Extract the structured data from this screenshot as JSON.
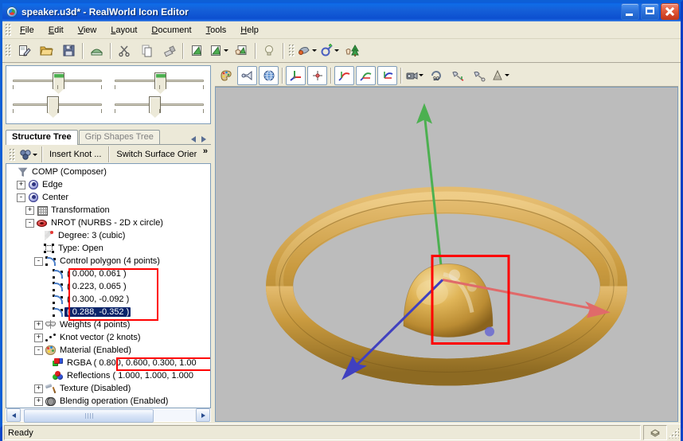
{
  "window": {
    "title": "speaker.u3d* - RealWorld Icon Editor",
    "app_icon": "realworld-logo-icon",
    "minimize_label": "Minimize",
    "maximize_label": "Maximize",
    "close_label": "Close"
  },
  "menu": {
    "items": [
      {
        "label": "File",
        "mnemonic": "F"
      },
      {
        "label": "Edit",
        "mnemonic": "E"
      },
      {
        "label": "View",
        "mnemonic": "V"
      },
      {
        "label": "Layout",
        "mnemonic": "L"
      },
      {
        "label": "Document",
        "mnemonic": "D"
      },
      {
        "label": "Tools",
        "mnemonic": "T"
      },
      {
        "label": "Help",
        "mnemonic": "H"
      }
    ]
  },
  "toolbar": {
    "buttons": [
      {
        "name": "new-icon",
        "tip": "New"
      },
      {
        "name": "open-folder-icon",
        "tip": "Open"
      },
      {
        "name": "save-floppy-icon",
        "tip": "Save"
      },
      {
        "name": "print-icon",
        "tip": "Print"
      },
      {
        "name": "cut-scissors-icon",
        "tip": "Cut"
      },
      {
        "name": "copy-icon",
        "tip": "Copy"
      },
      {
        "name": "paste-brush-icon",
        "tip": "Paste"
      },
      {
        "name": "undo-icon",
        "tip": "Undo"
      },
      {
        "name": "redo-icon",
        "tip": "Redo"
      },
      {
        "name": "apply-hand-icon",
        "tip": "Apply"
      },
      {
        "name": "light-bulb-icon",
        "tip": "Hints"
      },
      {
        "name": "color-dropper-icon",
        "tip": "Color"
      },
      {
        "name": "add-object-icon",
        "tip": "Add object"
      },
      {
        "name": "tree-object-icon",
        "tip": "Object library"
      }
    ]
  },
  "sliders": {
    "rows": [
      {
        "name": "slider-top-left",
        "value_pct": 50,
        "accent": "#4caf50"
      },
      {
        "name": "slider-bottom-left",
        "value_pct": 44,
        "accent": ""
      },
      {
        "name": "slider-top-right",
        "value_pct": 50,
        "accent": "#4caf50"
      },
      {
        "name": "slider-bottom-right",
        "value_pct": 44,
        "accent": ""
      }
    ]
  },
  "tabs": {
    "items": [
      {
        "label": "Structure Tree",
        "active": true
      },
      {
        "label": "Grip Shapes Tree",
        "active": false
      }
    ],
    "nav_prev": "scroll-tabs-left",
    "nav_next": "scroll-tabs-right"
  },
  "tree_toolbar": {
    "dropdown_icon": "object-menu-icon",
    "buttons": [
      {
        "label": "Insert Knot ..."
      },
      {
        "label": "Switch Surface Orier"
      }
    ],
    "overflow_label": "»"
  },
  "tree": {
    "nodes": [
      {
        "label": "COMP (Composer)",
        "depth": 0,
        "expander": "",
        "icon": "comp-funnel-icon"
      },
      {
        "label": "Edge",
        "depth": 1,
        "expander": "+",
        "icon": "edge-node-icon"
      },
      {
        "label": "Center",
        "depth": 1,
        "expander": "-",
        "icon": "center-node-icon"
      },
      {
        "label": "Transformation",
        "depth": 2,
        "expander": "+",
        "icon": "transformation-grid-icon"
      },
      {
        "label": "NROT (NURBS - 2D x circle)",
        "depth": 2,
        "expander": "-",
        "icon": "nrot-torus-icon"
      },
      {
        "label": "Degree: 3 (cubic)",
        "depth": 3,
        "expander": "",
        "icon": "degree-thermometer-icon"
      },
      {
        "label": "Type: Open",
        "depth": 3,
        "expander": "",
        "icon": "type-polygon-icon"
      },
      {
        "label": "Control polygon (4 points)",
        "depth": 3,
        "expander": "-",
        "icon": "control-polygon-icon"
      },
      {
        "label": "( 0.000, 0.061 )",
        "depth": 4,
        "expander": "",
        "icon": "control-point-icon"
      },
      {
        "label": "( 0.223, 0.065 )",
        "depth": 4,
        "expander": "",
        "icon": "control-point-icon"
      },
      {
        "label": "( 0.300, -0.092 )",
        "depth": 4,
        "expander": "",
        "icon": "control-point-icon"
      },
      {
        "label": "( 0.288, -0.352 )",
        "depth": 4,
        "expander": "",
        "icon": "control-point-icon",
        "selected": true
      },
      {
        "label": "Weights (4 points)",
        "depth": 3,
        "expander": "+",
        "icon": "weights-scale-icon"
      },
      {
        "label": "Knot vector (2 knots)",
        "depth": 3,
        "expander": "+",
        "icon": "knot-vector-icon"
      },
      {
        "label": "Material (Enabled)",
        "depth": 3,
        "expander": "-",
        "icon": "material-palette-icon"
      },
      {
        "label": "RGBA ( 0.800, 0.600, 0.300, 1.00",
        "depth": 4,
        "expander": "",
        "icon": "rgba-cubes-icon"
      },
      {
        "label": "Reflections ( 1.000, 1.000, 1.000",
        "depth": 4,
        "expander": "",
        "icon": "reflections-spheres-icon"
      },
      {
        "label": "Texture (Disabled)",
        "depth": 3,
        "expander": "+",
        "icon": "texture-hammer-icon"
      },
      {
        "label": "Blendig operation (Enabled)",
        "depth": 3,
        "expander": "+",
        "icon": "blending-circles-icon"
      }
    ],
    "annotations": [
      {
        "name": "control-points-highlight-box",
        "color": "#ff0000"
      },
      {
        "name": "rgba-highlight-box",
        "color": "#ff0000"
      }
    ],
    "hscroll": {
      "name": "tree-horizontal-scrollbar",
      "thumb_pct": 74
    }
  },
  "viewport_toolbar": {
    "buttons": [
      {
        "name": "material-palette-icon",
        "pressed": false
      },
      {
        "name": "flashlight-icon",
        "pressed": true
      },
      {
        "name": "globe-environment-icon",
        "pressed": true
      },
      {
        "name": "move-axes-icon",
        "pressed": true
      },
      {
        "name": "grip-points-icon",
        "pressed": true
      },
      {
        "name": "rotate-x-icon",
        "pressed": true
      },
      {
        "name": "rotate-y-icon",
        "pressed": true
      },
      {
        "name": "rotate-z-icon",
        "pressed": true
      },
      {
        "name": "camera-icon",
        "pressed": false,
        "dropdown": true
      },
      {
        "name": "rotate-90-icon",
        "pressed": false
      },
      {
        "name": "pin-axis-icon",
        "pressed": false
      },
      {
        "name": "pin-point-icon",
        "pressed": false
      },
      {
        "name": "cone-primitive-icon",
        "pressed": false,
        "dropdown": true
      }
    ]
  },
  "viewport": {
    "name": "3d-preview-viewport",
    "background_color": "#bcbcbc",
    "objects": [
      {
        "name": "torus-ring",
        "color": "#c8963c",
        "shape": "torus"
      },
      {
        "name": "dome-sphere",
        "color": "#d7a63f",
        "shape": "dome"
      }
    ],
    "gizmo": {
      "name": "axis-gizmo",
      "axes": [
        {
          "name": "y-axis-arrow",
          "color": "#4cb050",
          "direction": "up"
        },
        {
          "name": "x-axis-arrow",
          "color": "#e06060",
          "direction": "right"
        },
        {
          "name": "z-axis-arrow",
          "color": "#4040c0",
          "direction": "down-left"
        }
      ]
    },
    "selection_box": {
      "name": "selection-highlight-box",
      "color": "#ff0000"
    }
  },
  "statusbar": {
    "message": "Ready",
    "indicator_icon": "layers-stack-icon",
    "resize_grip": "resize-grip"
  }
}
